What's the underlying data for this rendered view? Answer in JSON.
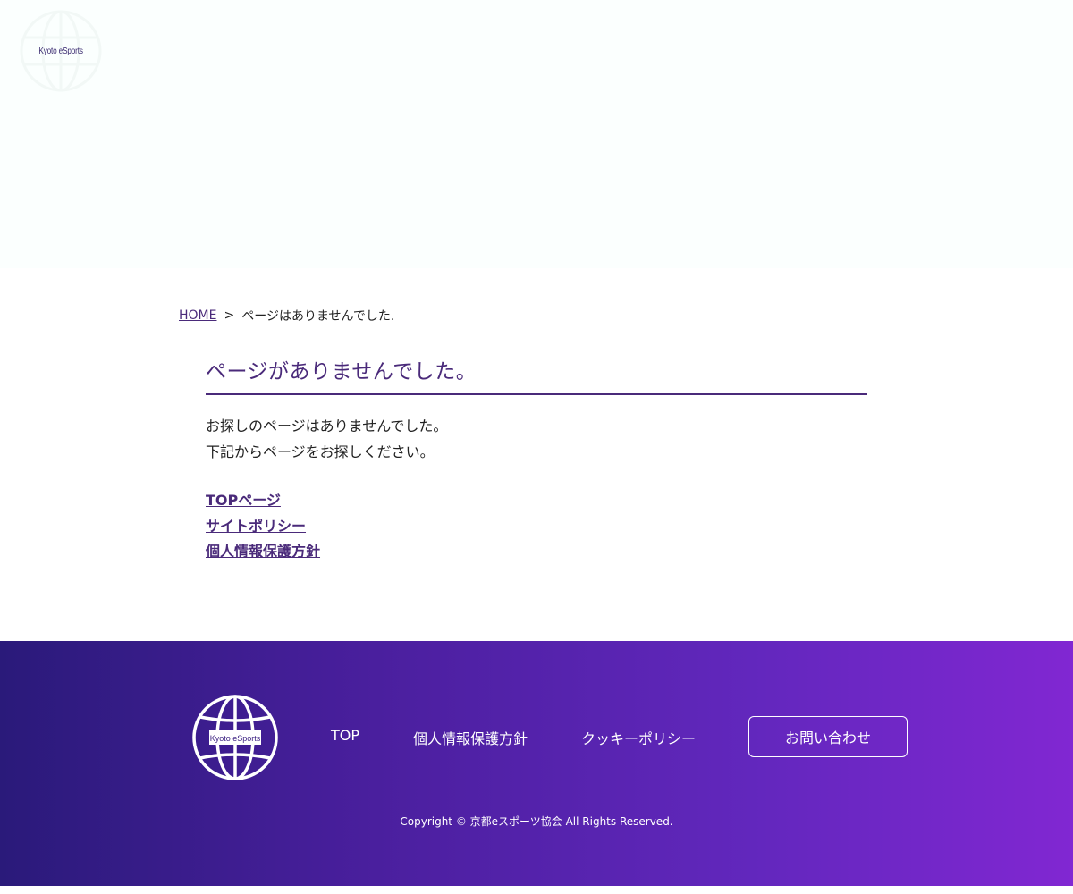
{
  "header": {
    "logo_text": "Kyoto eSports"
  },
  "breadcrumb": {
    "home_label": "HOME",
    "separator": ">",
    "current": "ページはありませんでした."
  },
  "main": {
    "title": "ページがありませんでした。",
    "message_line1": "お探しのページはありませんでした。",
    "message_line2": "下記からページをお探しください。",
    "links": [
      {
        "label": "TOPページ"
      },
      {
        "label": "サイトポリシー"
      },
      {
        "label": "個人情報保護方針"
      }
    ]
  },
  "footer": {
    "logo_text": "Kyoto eSports",
    "nav": [
      {
        "label": "TOP"
      },
      {
        "label": "個人情報保護方針"
      },
      {
        "label": "クッキーポリシー"
      }
    ],
    "contact_label": "お問い合わせ",
    "copyright": "Copyright © 京都eスポーツ協会 All Rights Reserved."
  },
  "colors": {
    "accent": "#4a2a7a",
    "footer_gradient_start": "#2a1a7a",
    "footer_gradient_end": "#8127d2",
    "hero_background": "#fbfffe"
  }
}
